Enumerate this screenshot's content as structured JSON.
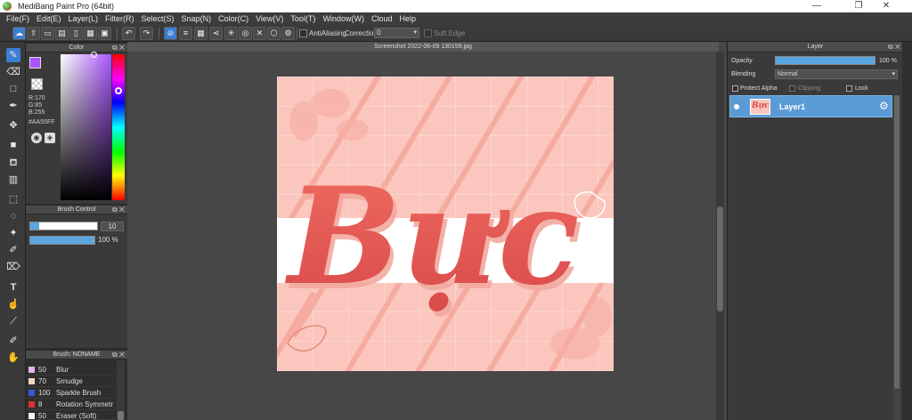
{
  "titlebar": {
    "title": "MediBang Paint Pro (64bit)",
    "minimize": "—",
    "maximize": "❐",
    "close": "✕"
  },
  "menu": [
    "File(F)",
    "Edit(E)",
    "Layer(L)",
    "Filter(R)",
    "Select(S)",
    "Snap(N)",
    "Color(C)",
    "View(V)",
    "Tool(T)",
    "Window(W)",
    "Cloud",
    "Help"
  ],
  "toolbar": {
    "antialiasing_label": "AntiAliasing",
    "correction_label": "Correction",
    "correction_value": "0",
    "softedge_label": "Soft Edge"
  },
  "color_panel": {
    "title": "Color",
    "r": "R:170",
    "g": "G:85",
    "b": "B:255",
    "hex": "#AA55FF",
    "primary_color": "#aa55ff"
  },
  "brush_control": {
    "title": "Brush Control",
    "size_value": "10",
    "opacity_value": "100 %",
    "size_fraction": 0.13,
    "opacity_fraction": 1.0
  },
  "brush_panel": {
    "title": "Brush: NONAME",
    "brushes": [
      {
        "size": "50",
        "name": "Blur",
        "color": "#e7b4f0"
      },
      {
        "size": "70",
        "name": "Smudge",
        "color": "#f3d6bd"
      },
      {
        "size": "100",
        "name": "Sparkle Brush",
        "color": "#3d56d6"
      },
      {
        "size": "8",
        "name": "Rotation Symmetr",
        "color": "#e03030"
      },
      {
        "size": "50",
        "name": "Eraser (Soft)",
        "color": "#f2f2f2"
      }
    ]
  },
  "canvas": {
    "tab_title": "Screenshot 2022-06-09 130159.jpg",
    "artwork_text": "Bực"
  },
  "layer_panel": {
    "title": "Layer",
    "opacity_label": "Opacity",
    "opacity_value": "100 %",
    "opacity_fraction": 1.0,
    "blending_label": "Blending",
    "blending_value": "Normal",
    "protect_alpha": "Protect Alpha",
    "clipping": "Clipping",
    "lock": "Lock",
    "layers": [
      {
        "name": "Layer1",
        "thumb_text": "Bực"
      }
    ]
  }
}
